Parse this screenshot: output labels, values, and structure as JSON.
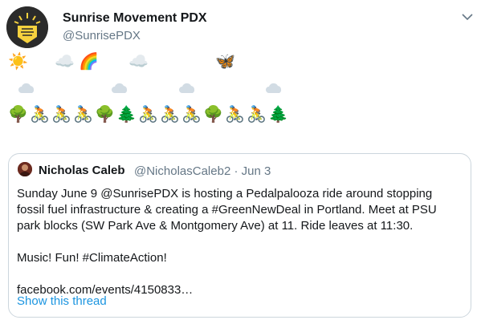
{
  "tweet": {
    "author_name": "Sunrise Movement PDX",
    "author_handle": "@SunrisePDX",
    "emoji_row1": [
      "☀️",
      "☁️",
      "🌈",
      "☁️",
      "🦋"
    ],
    "emoji_row3": [
      "🌳",
      "🚴",
      "🚴",
      "🚴",
      "🌳",
      "🌲",
      "🚴",
      "🚴",
      "🚴",
      "🌳",
      "🚴",
      "🚴",
      "🌲"
    ]
  },
  "quoted": {
    "author_name": "Nicholas Caleb",
    "meta": "@NicholasCaleb2 · Jun 3",
    "lines": [
      "Sunday June 9 @SunrisePDX is hosting a Pedalpalooza ride around stopping",
      "fossil fuel infrastructure & creating a #GreenNewDeal in Portland. Meet at PSU",
      "park blocks (SW Park Ave & Montgomery Ave) at 11. Ride leaves at 11:30.",
      "",
      "Music! Fun! #ClimateAction!",
      "",
      "facebook.com/events/4150833…"
    ],
    "show_thread": "Show this thread"
  },
  "colors": {
    "link": "#1b95e0",
    "muted": "#657786",
    "border": "#ccd6dd",
    "logo_yellow": "#f7d23e"
  }
}
